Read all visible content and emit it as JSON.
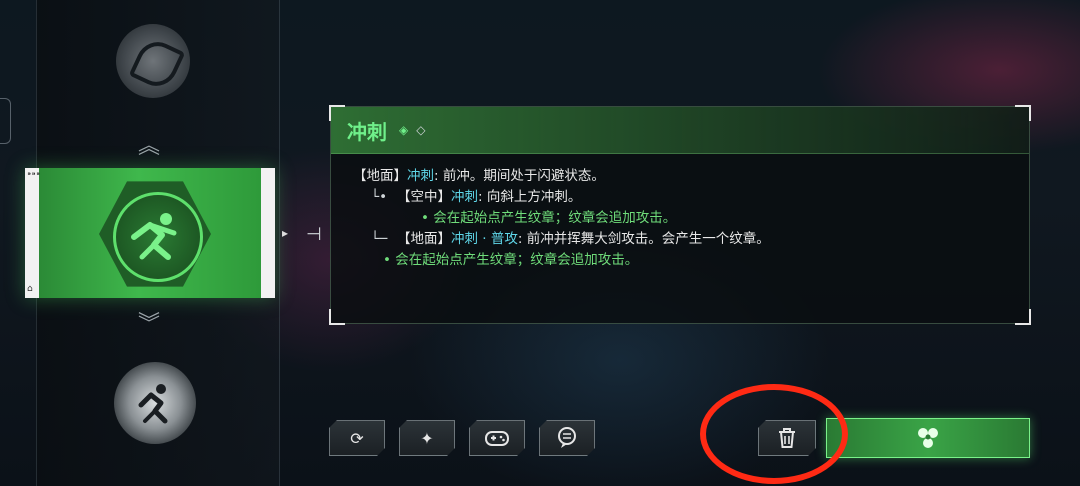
{
  "skill": {
    "title": "冲刺",
    "lines": [
      {
        "prefix": "【地面】",
        "name": "冲刺",
        "text": ": 前冲。期间处于闪避状态。"
      },
      {
        "prefix": "【空中】",
        "name": "冲刺",
        "text": ": 向斜上方冲刺。"
      },
      {
        "bullet": "• 会在起始点产生纹章；纹章会追加攻击。"
      },
      {
        "prefix": "【地面】",
        "name": "冲刺 · 普攻",
        "text": ": 前冲并挥舞大剑攻击。会产生一个纹章。"
      },
      {
        "bullet": "• 会在起始点产生纹章；纹章会追加攻击。"
      }
    ]
  },
  "toolbar": {
    "buttons": [
      {
        "icon": "swap-icon",
        "glyph": "⟳"
      },
      {
        "icon": "sparkle-icon",
        "glyph": "✦"
      },
      {
        "icon": "gamepad-icon",
        "glyph": "🎮"
      },
      {
        "icon": "chat-icon",
        "glyph": "☰"
      }
    ],
    "trash_icon": "trash-icon",
    "confirm_icon": "equip-icon"
  },
  "colors": {
    "accent_green": "#3fb84c",
    "highlight_cyan": "#5fd6e8",
    "annotation_red": "#ff2a14"
  }
}
